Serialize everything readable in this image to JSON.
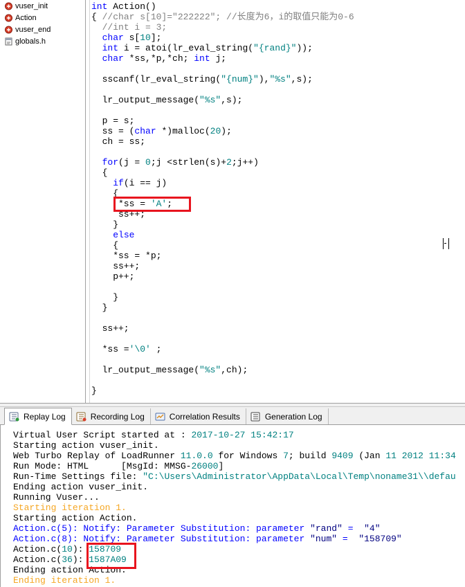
{
  "tree": {
    "items": [
      {
        "label": "vuser_init",
        "icon": "script-file-icon"
      },
      {
        "label": "Action",
        "icon": "script-file-icon"
      },
      {
        "label": "vuser_end",
        "icon": "script-file-icon"
      },
      {
        "label": "globals.h",
        "icon": "header-file-icon"
      }
    ]
  },
  "code": {
    "lines": [
      [
        {
          "t": "int",
          "c": "kw"
        },
        {
          "t": " Action()"
        }
      ],
      [
        {
          "t": "{ "
        },
        {
          "t": "//char s[10]=\"222222\"; //长度为6，i的取值只能为0-6",
          "c": "cm"
        }
      ],
      [
        {
          "t": "  "
        },
        {
          "t": "//int i = 3;",
          "c": "cm"
        }
      ],
      [
        {
          "t": "  "
        },
        {
          "t": "char",
          "c": "kw"
        },
        {
          "t": " s["
        },
        {
          "t": "10",
          "c": "nm"
        },
        {
          "t": "];"
        }
      ],
      [
        {
          "t": "  "
        },
        {
          "t": "int",
          "c": "kw"
        },
        {
          "t": " i = atoi(lr_eval_string("
        },
        {
          "t": "\"{rand}\"",
          "c": "st"
        },
        {
          "t": "));"
        }
      ],
      [
        {
          "t": "  "
        },
        {
          "t": "char",
          "c": "kw"
        },
        {
          "t": " *ss,*p,*ch; "
        },
        {
          "t": "int",
          "c": "kw"
        },
        {
          "t": " j;"
        }
      ],
      [
        {
          "t": ""
        }
      ],
      [
        {
          "t": "  sscanf(lr_eval_string("
        },
        {
          "t": "\"{num}\"",
          "c": "st"
        },
        {
          "t": "),"
        },
        {
          "t": "\"%s\"",
          "c": "st"
        },
        {
          "t": ",s);"
        }
      ],
      [
        {
          "t": ""
        }
      ],
      [
        {
          "t": "  lr_output_message("
        },
        {
          "t": "\"%s\"",
          "c": "st"
        },
        {
          "t": ",s);"
        }
      ],
      [
        {
          "t": ""
        }
      ],
      [
        {
          "t": "  p = s;"
        }
      ],
      [
        {
          "t": "  ss = ("
        },
        {
          "t": "char",
          "c": "kw"
        },
        {
          "t": " *)malloc("
        },
        {
          "t": "20",
          "c": "nm"
        },
        {
          "t": ");"
        }
      ],
      [
        {
          "t": "  ch = ss;"
        }
      ],
      [
        {
          "t": ""
        }
      ],
      [
        {
          "t": "  "
        },
        {
          "t": "for",
          "c": "kw"
        },
        {
          "t": "(j = "
        },
        {
          "t": "0",
          "c": "nm"
        },
        {
          "t": ";j <strlen(s)+"
        },
        {
          "t": "2",
          "c": "nm"
        },
        {
          "t": ";j++)"
        }
      ],
      [
        {
          "t": "  {"
        }
      ],
      [
        {
          "t": "    "
        },
        {
          "t": "if",
          "c": "kw"
        },
        {
          "t": "(i == j)"
        }
      ],
      [
        {
          "t": "    {"
        }
      ],
      [
        {
          "t": "     *ss = "
        },
        {
          "t": "'A'",
          "c": "st"
        },
        {
          "t": ";"
        }
      ],
      [
        {
          "t": "     ss++;"
        }
      ],
      [
        {
          "t": "    }"
        }
      ],
      [
        {
          "t": "    "
        },
        {
          "t": "else",
          "c": "kw"
        }
      ],
      [
        {
          "t": "    {"
        }
      ],
      [
        {
          "t": "    *ss = *p;"
        }
      ],
      [
        {
          "t": "    ss++;"
        }
      ],
      [
        {
          "t": "    p++;"
        }
      ],
      [
        {
          "t": ""
        }
      ],
      [
        {
          "t": "    }"
        }
      ],
      [
        {
          "t": "  }"
        }
      ],
      [
        {
          "t": ""
        }
      ],
      [
        {
          "t": "  ss++;"
        }
      ],
      [
        {
          "t": ""
        }
      ],
      [
        {
          "t": "  *ss ="
        },
        {
          "t": "'\\0'",
          "c": "st"
        },
        {
          "t": " ;"
        }
      ],
      [
        {
          "t": ""
        }
      ],
      [
        {
          "t": "  lr_output_message("
        },
        {
          "t": "\"%s\"",
          "c": "st"
        },
        {
          "t": ",ch);"
        }
      ],
      [
        {
          "t": ""
        }
      ],
      [
        {
          "t": "}"
        }
      ]
    ]
  },
  "tabs": [
    {
      "label": "Replay Log",
      "icon": "replay-log-icon",
      "active": true
    },
    {
      "label": "Recording Log",
      "icon": "recording-log-icon",
      "active": false
    },
    {
      "label": "Correlation Results",
      "icon": "correlation-results-icon",
      "active": false
    },
    {
      "label": "Generation Log",
      "icon": "generation-log-icon",
      "active": false
    }
  ],
  "log": {
    "lines": [
      [
        {
          "t": "Virtual User Script started at : "
        },
        {
          "t": "2017-10-27 15:42:17",
          "c": "lg-teal"
        }
      ],
      [
        {
          "t": "Starting action vuser_init."
        }
      ],
      [
        {
          "t": "Web Turbo Replay of LoadRunner "
        },
        {
          "t": "11.0.0",
          "c": "lg-teal"
        },
        {
          "t": " for Windows "
        },
        {
          "t": "7",
          "c": "lg-teal"
        },
        {
          "t": "; build "
        },
        {
          "t": "9409",
          "c": "lg-teal"
        },
        {
          "t": " (Jan "
        },
        {
          "t": "11 2012 11:34",
          "c": "lg-teal"
        }
      ],
      [
        {
          "t": "Run Mode: HTML      [MsgId: MMSG-"
        },
        {
          "t": "26000",
          "c": "lg-teal"
        },
        {
          "t": "]"
        }
      ],
      [
        {
          "t": "Run-Time Settings file: "
        },
        {
          "t": "\"C:\\Users\\Administrator\\AppData\\Local\\Temp\\noname31\\\\defau",
          "c": "lg-teal"
        }
      ],
      [
        {
          "t": "Ending action vuser_init."
        }
      ],
      [
        {
          "t": "Running Vuser..."
        }
      ],
      [
        {
          "t": "Starting iteration 1.",
          "c": "lg-orange"
        }
      ],
      [
        {
          "t": "Starting action Action."
        }
      ],
      [
        {
          "t": "Action.c(5): Notify: Parameter Substitution: parameter ",
          "c": "lg-blue"
        },
        {
          "t": "\"rand\"",
          "c": "lg-navy"
        },
        {
          "t": " =  ",
          "c": "lg-blue"
        },
        {
          "t": "\"4\"",
          "c": "lg-navy"
        }
      ],
      [
        {
          "t": "Action.c(8): Notify: Parameter Substitution: parameter ",
          "c": "lg-blue"
        },
        {
          "t": "\"num\"",
          "c": "lg-navy"
        },
        {
          "t": " =  ",
          "c": "lg-blue"
        },
        {
          "t": "\"158709\"",
          "c": "lg-navy"
        }
      ],
      [
        {
          "t": "Action.c("
        },
        {
          "t": "10",
          "c": "lg-teal"
        },
        {
          "t": "): "
        },
        {
          "t": "158709",
          "c": "lg-teal"
        }
      ],
      [
        {
          "t": "Action.c("
        },
        {
          "t": "36",
          "c": "lg-teal"
        },
        {
          "t": "): "
        },
        {
          "t": "1587A09",
          "c": "lg-teal"
        }
      ],
      [
        {
          "t": "Ending action Action."
        }
      ],
      [
        {
          "t": "Ending iteration 1.",
          "c": "lg-orange"
        }
      ]
    ]
  },
  "colors": {
    "highlight_box": "#e8141e",
    "keyword": "#0000ff",
    "comment": "#808080",
    "string": "#008080"
  }
}
